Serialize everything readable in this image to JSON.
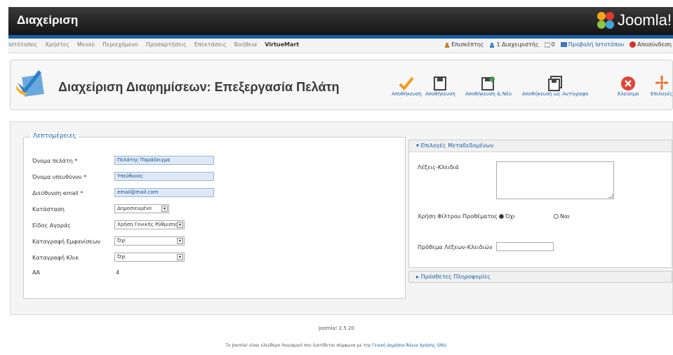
{
  "header": {
    "title": "Διαχείριση",
    "logo_text": "Joomla!"
  },
  "menu": [
    "Ιστότοπος",
    "Χρήστες",
    "Μενού",
    "Περιεχόμενο",
    "Προσαρτήσεις",
    "Επεκτάσεις",
    "Βοήθεια",
    "VirtueMart"
  ],
  "status": [
    "Επισκέπτης",
    "1 Διαχειριστής",
    "0",
    "Προβολή Ιστοτόπου",
    "Αποσύνδεση"
  ],
  "page": {
    "title": "Διαχείριση Διαφημίσεων: Επεξεργασία Πελάτη"
  },
  "toolbar": [
    "Αποθήκευση",
    "Αποθήκευση",
    "Αποθήκευση & Νέο",
    "Αποθήκευση ως Αντίγραφο",
    "Κλείσιμο",
    "Επιλογές"
  ],
  "details": {
    "legend": "Λεπτομέρειες",
    "fields": [
      {
        "label": "Όνομα πελάτη *",
        "value": "Πελάτης Παράδειγμα"
      },
      {
        "label": "Όνομα υπευθύνου *",
        "value": "Υπεύθυνος"
      },
      {
        "label": "Διεύθυνση email *",
        "value": "email@mail.com"
      },
      {
        "label": "Κατάσταση",
        "value": "Δημοσιευμένο"
      },
      {
        "label": "Είδος Αγοράς",
        "value": "Χρήση Γονικής Ρύθμισης"
      },
      {
        "label": "Καταγραφή Εμφανίσεων",
        "value": "Όχι"
      },
      {
        "label": "Καταγραφή Κλικ",
        "value": "Όχι"
      },
      {
        "label": "ΑΑ",
        "value": "4"
      }
    ]
  },
  "meta": {
    "title": "Επιλογές Μεταδεδομένων",
    "keywords_label": "Λέξεις-Κλειδιά",
    "prefix_mode_label": "Χρήση Φίλτρου Προθέματος",
    "opt_no": "Όχι",
    "opt_yes": "Ναι",
    "prefix_label": "Πρόθεμα Λέξεων-Κλειδιών"
  },
  "extra": {
    "title": "Πρόσθετες Πληροφορίες"
  },
  "footer": {
    "version": "Joomla! 2.5.20",
    "text": "Το Joomla! είναι ελεύθερο λογισμικό που διατίθεται σύμφωνα με την ",
    "license": "Γενική Δημόσια Άδεια Χρήσης GNU."
  },
  "colors": {
    "accent": "#1a5fa8",
    "topbar": "#151515"
  }
}
